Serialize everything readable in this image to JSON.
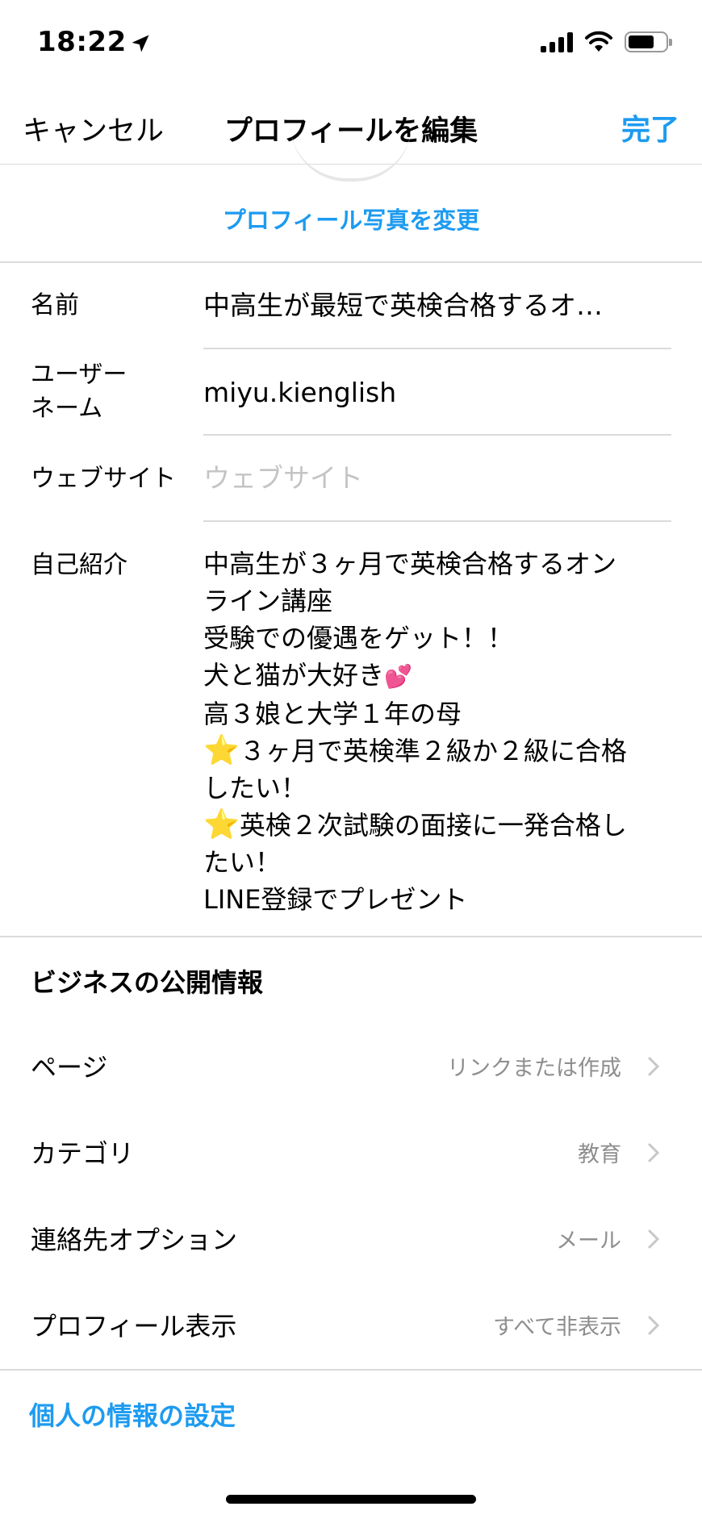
{
  "status_bar": {
    "time": "18:22"
  },
  "nav": {
    "cancel": "キャンセル",
    "title": "プロフィールを編集",
    "done": "完了"
  },
  "photo": {
    "change_label": "プロフィール写真を変更"
  },
  "form": {
    "name_label": "名前",
    "name_value": "中高生が最短で英検合格するオ…",
    "username_label_line1": "ユーザー",
    "username_label_line2": "ネーム",
    "username_value": "miyu.kienglish",
    "website_label": "ウェブサイト",
    "website_placeholder": "ウェブサイト",
    "bio_label": "自己紹介",
    "bio_lines": [
      "中高生が３ヶ月で英検合格するオン",
      "ライン講座",
      "受験での優遇をゲット！！",
      "犬と猫が大好き",
      "高３娘と大学１年の母",
      "３ヶ月で英検準２級か２級に合格",
      "したい！",
      "英検２次試験の面接に一発合格し",
      "たい！",
      "LINE登録でプレゼント"
    ],
    "bio_emoji": {
      "heart": "💕",
      "star": "⭐"
    }
  },
  "business": {
    "title": "ビジネスの公開情報",
    "rows": [
      {
        "label": "ページ",
        "value": "リンクまたは作成"
      },
      {
        "label": "カテゴリ",
        "value": "教育"
      },
      {
        "label": "連絡先オプション",
        "value": "メール"
      },
      {
        "label": "プロフィール表示",
        "value": "すべて非表示"
      }
    ]
  },
  "personal_settings": "個人の情報の設定",
  "colors": {
    "accent": "#1d9bf0",
    "secondary_text": "#8e8e8e",
    "separator": "#dbdbdb"
  }
}
